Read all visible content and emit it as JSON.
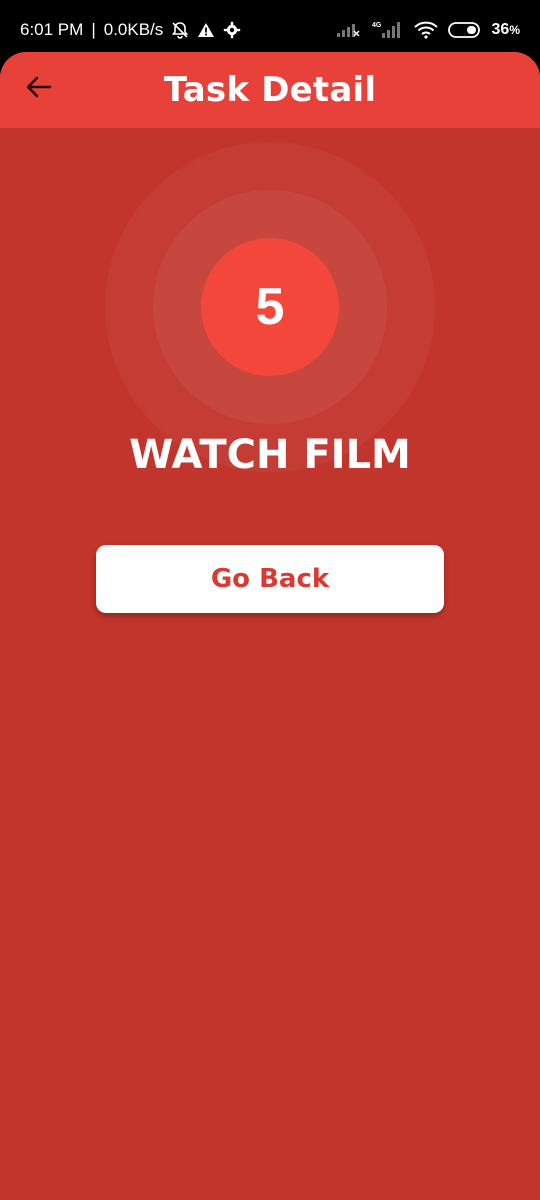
{
  "status_bar": {
    "time": "6:01 PM",
    "separator": "|",
    "network_speed": "0.0KB/s",
    "battery_percent": "36",
    "battery_unit": "%",
    "network_type_label": "4G",
    "icons": [
      "notification-muted-icon",
      "alert-icon",
      "settings-icon",
      "signal-icon",
      "signal-4g-icon",
      "wifi-icon",
      "battery-icon"
    ]
  },
  "app_bar": {
    "title": "Task Detail",
    "back_icon": "arrow-left-icon"
  },
  "task": {
    "count": "5",
    "name": "WATCH FILM"
  },
  "actions": {
    "go_back_label": "Go Back"
  },
  "colors": {
    "app_bar": "#e84139",
    "background": "#c2352c",
    "count_circle": "#f4473c",
    "button_text": "#d93a33"
  }
}
